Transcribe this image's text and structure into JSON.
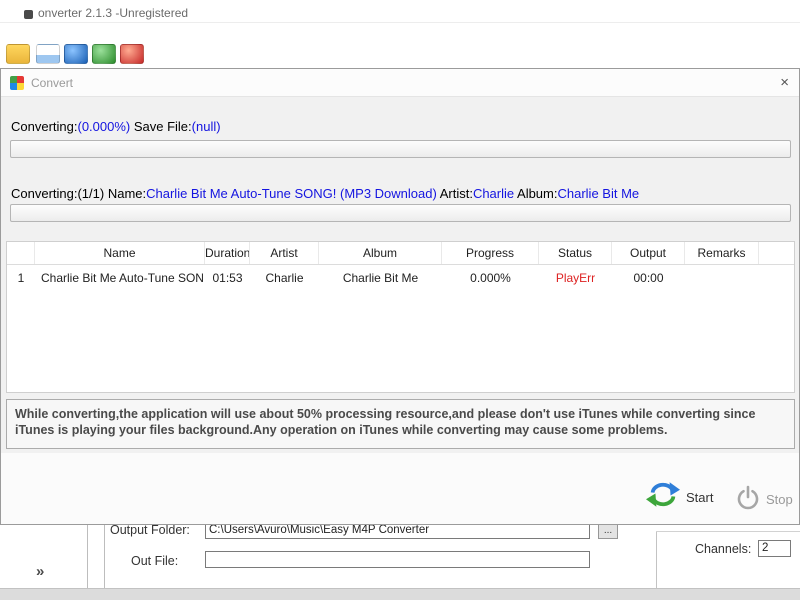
{
  "main_window": {
    "title": "onverter 2.1.3 -Unregistered",
    "output_folder_label": "Output Folder:",
    "output_folder_value": "C:\\Users\\Avuro\\Music\\Easy M4P Converter",
    "browse_button": "...",
    "out_file_label": "Out File:",
    "out_file_value": "",
    "channels_label": "Channels:",
    "channels_value": "2",
    "collapse_chevron": "»"
  },
  "dialog": {
    "title": "Convert",
    "close_glyph": "×",
    "line1": {
      "prefix": "Converting:",
      "percent": "(0.000%)",
      "save_label": " Save File:",
      "save_value": "(null)"
    },
    "line2": {
      "prefix": "Converting:(1/1) Name:",
      "name": "Charlie Bit Me Auto-Tune SONG! (MP3 Download)",
      "artist_label": " Artist:",
      "artist": "Charlie",
      "album_label": " Album:",
      "album": "Charlie Bit Me"
    },
    "table": {
      "headers": [
        "",
        "Name",
        "Duration",
        "Artist",
        "Album",
        "Progress",
        "Status",
        "Output",
        "Remarks"
      ],
      "rows": [
        {
          "num": "1",
          "name": "Charlie Bit Me Auto-Tune SON...",
          "duration": "01:53",
          "artist": "Charlie",
          "album": "Charlie Bit Me",
          "progress": "0.000%",
          "status": "PlayErr",
          "output": "00:00",
          "remarks": ""
        }
      ]
    },
    "notice": "While converting,the application will use about 50% processing resource,and please don't use iTunes while converting since iTunes is playing your files background.Any operation on iTunes while converting may cause some problems.",
    "start_label": "Start",
    "stop_label": "Stop"
  },
  "icons": {
    "dialog_logo": "app-logo-icon",
    "start": "sync-arrows-icon",
    "stop": "power-icon",
    "close": "close-icon",
    "toolbar": [
      "folder-icon",
      "document-icon",
      "blue-orb-icon",
      "green-orb-icon",
      "red-orb-icon"
    ]
  },
  "colors": {
    "link_blue": "#1414e0",
    "error_red": "#dd2222",
    "start_green": "#3da63b",
    "start_blue": "#2f7ed8",
    "stop_gray": "#a6a6a6"
  }
}
